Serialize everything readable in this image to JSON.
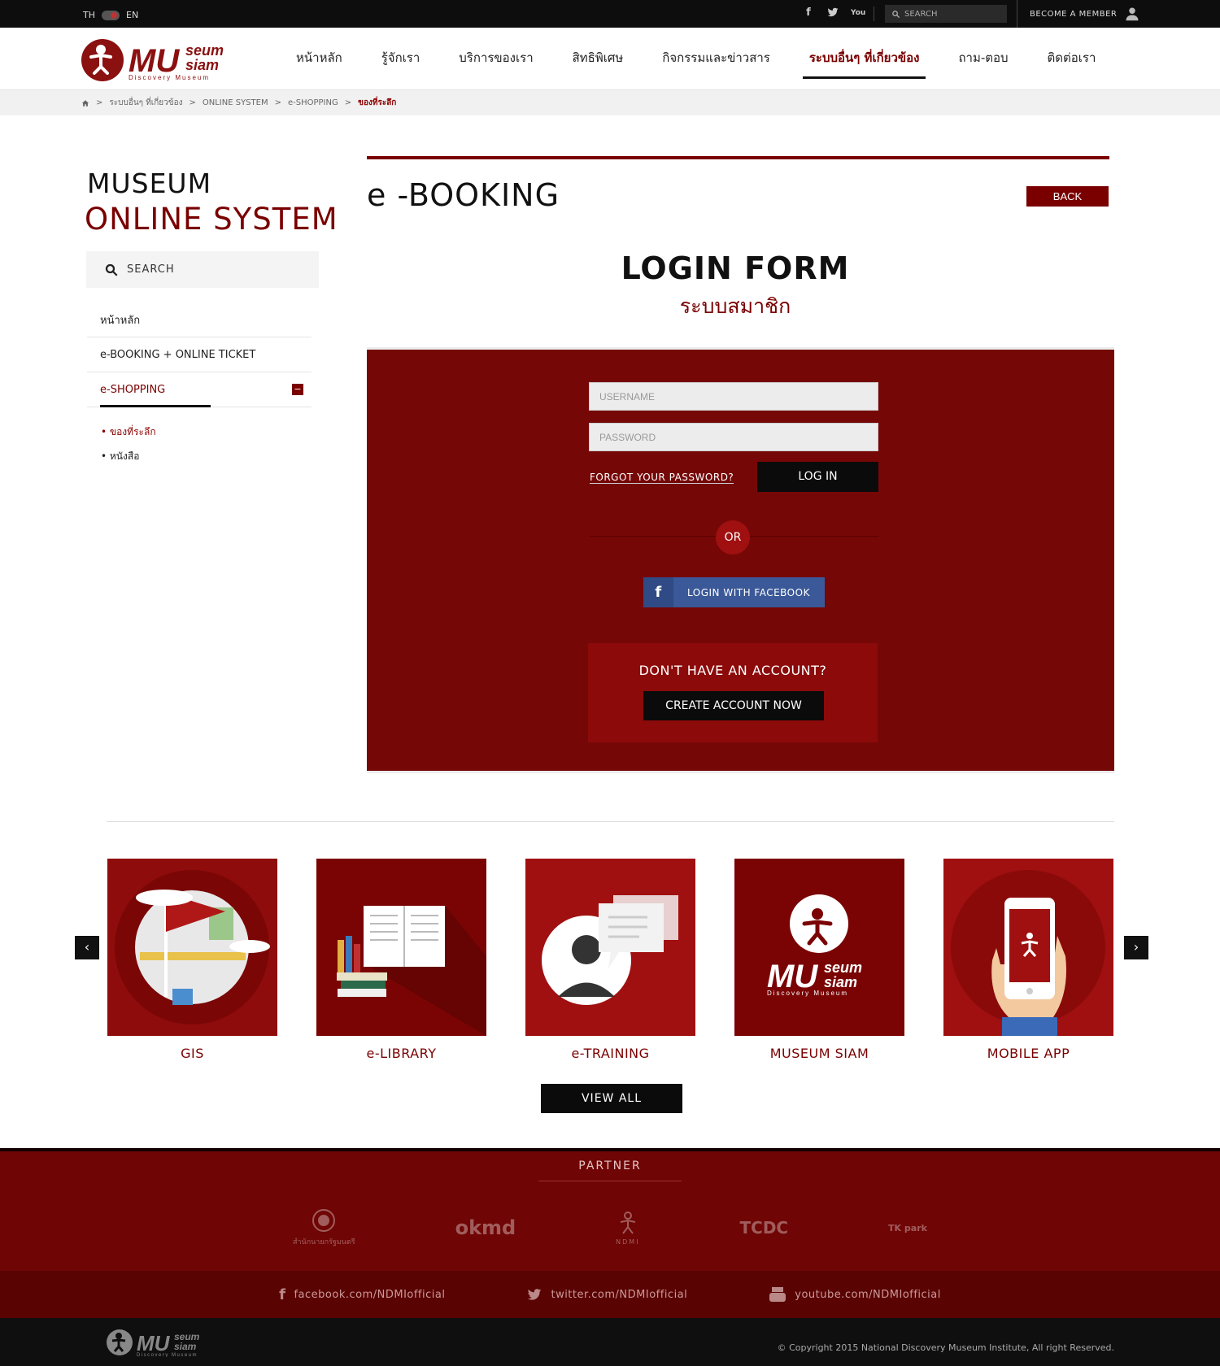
{
  "topbar": {
    "lang_th": "TH",
    "lang_en": "EN",
    "social": [
      "facebook-icon",
      "twitter-icon",
      "youtube-icon"
    ],
    "search_placeholder": "SEARCH",
    "member_label": "BECOME A MEMBER"
  },
  "header": {
    "logo_main": "MU",
    "logo_seum": "seum",
    "logo_siam": "siam",
    "logo_tagline": "Discovery Museum",
    "nav": [
      "หน้าหลัก",
      "รู้จักเรา",
      "บริการของเรา",
      "สิทธิพิเศษ",
      "กิจกรรมและข่าวสาร",
      "ระบบอื่นๆ ที่เกี่ยวข้อง",
      "ถาม-ตอบ",
      "ติดต่อเรา"
    ],
    "active_nav": 5
  },
  "breadcrumb": {
    "items": [
      "ระบบอื่นๆ ที่เกี่ยวข้อง",
      "ONLINE SYSTEM",
      "e-SHOPPING"
    ],
    "current": "ของที่ระลึก",
    "separator": ">"
  },
  "sidebar": {
    "title1": "MUSEUM",
    "title2": "ONLINE SYSTEM",
    "search_label": "SEARCH",
    "items": [
      "หน้าหลัก",
      "e-BOOKING + ONLINE TICKET",
      "e-SHOPPING"
    ],
    "subitems": [
      "• ของที่ระลึก",
      "• หนังสือ"
    ],
    "collapse_symbol": "−"
  },
  "main": {
    "page_title": "e -BOOKING",
    "back_label": "BACK",
    "login_title": "LOGIN FORM",
    "login_subtitle": "ระบบสมาชิก",
    "username_placeholder": "USERNAME",
    "password_placeholder": "PASSWORD",
    "forgot_label": "FORGOT YOUR PASSWORD?",
    "login_label": "LOG IN",
    "or_label": "OR",
    "facebook_label": "LOGIN WITH FACEBOOK",
    "no_account": "DON'T HAVE AN ACCOUNT?",
    "create_label": "CREATE ACCOUNT NOW"
  },
  "services": {
    "items": [
      "GIS",
      "e-LIBRARY",
      "e-TRAINING",
      "MUSEUM SIAM",
      "MOBILE APP"
    ],
    "view_all": "VIEW ALL",
    "prev": "‹",
    "next": "›"
  },
  "partner": {
    "title": "PARTNER",
    "logos": [
      "สำนักนายกรัฐมนตรี",
      "okmd",
      "NDMI",
      "TCDC",
      "TK park"
    ]
  },
  "social_footer": {
    "facebook": "facebook.com/NDMIofficial",
    "twitter": "twitter.com/NDMIofficial",
    "youtube": "youtube.com/NDMIofficial"
  },
  "footer": {
    "copyright": "© Copyright 2015 National Discovery Museum Institute, All right Reserved."
  },
  "colors": {
    "brand": "#7a0000",
    "panel": "#760707",
    "facebook": "#3b5998"
  }
}
